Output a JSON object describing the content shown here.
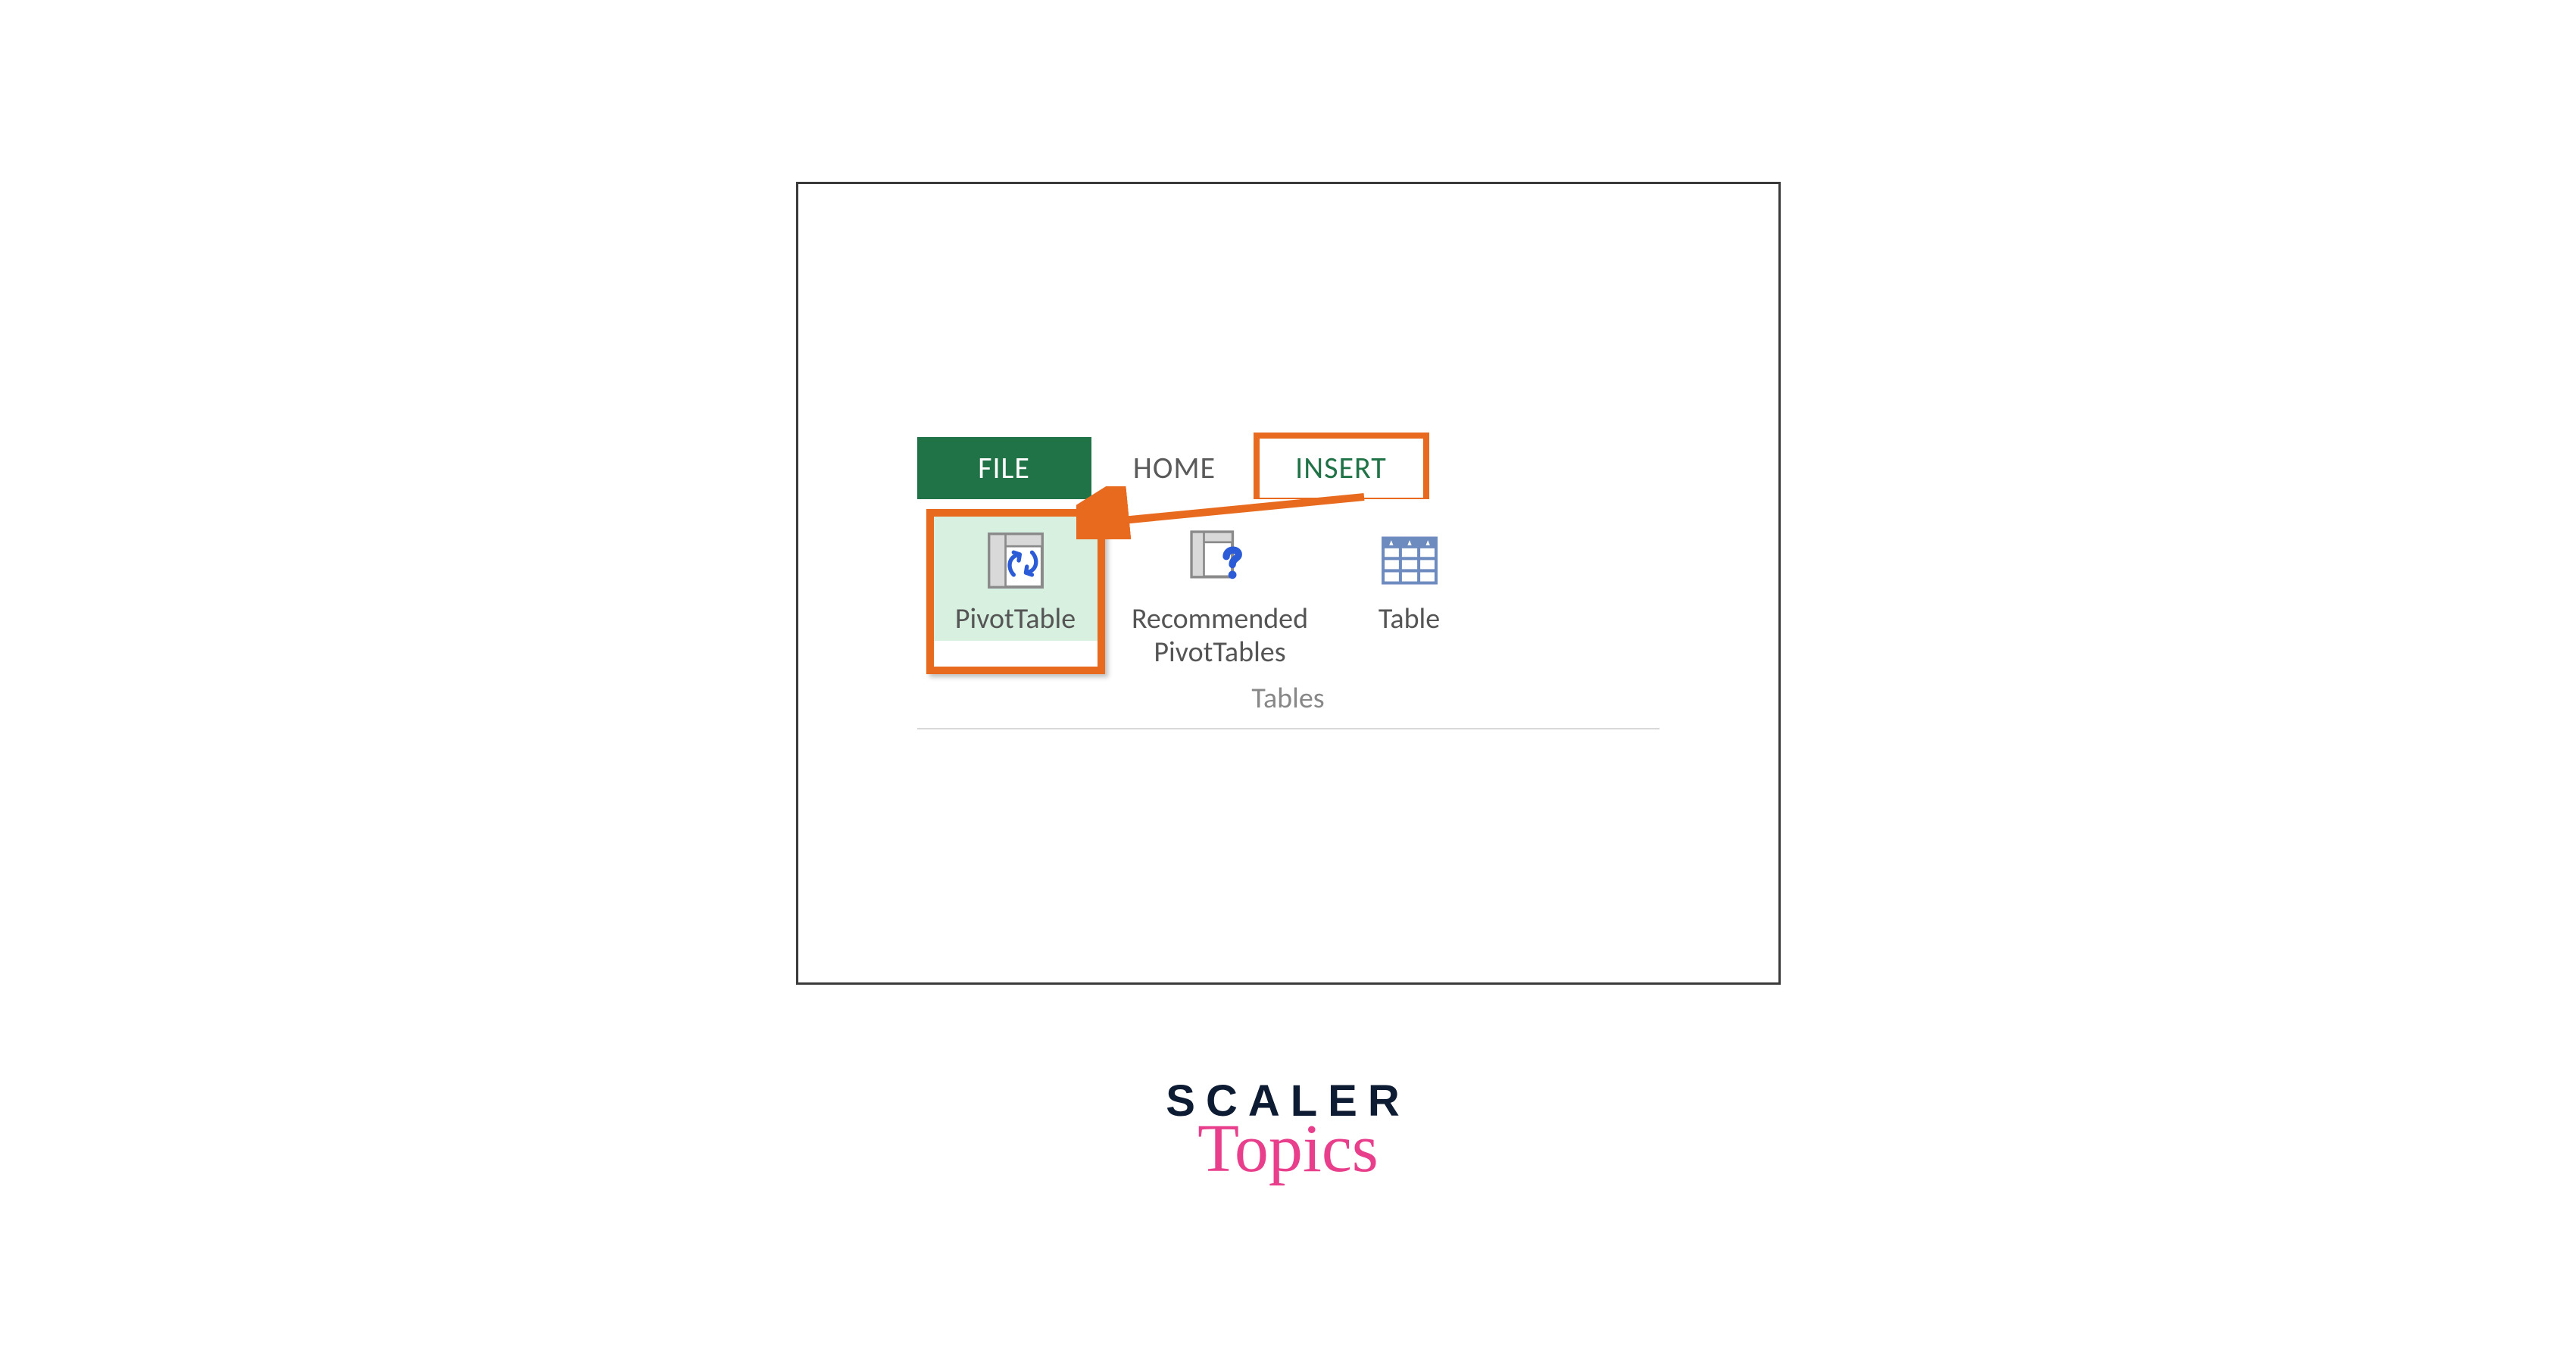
{
  "tabs": {
    "file": "FILE",
    "home": "HOME",
    "insert": "INSERT"
  },
  "commands": {
    "pivot_table": "PivotTable",
    "recommended": "Recommended\nPivotTables",
    "table": "Table"
  },
  "group_caption": "Tables",
  "highlight_color": "#e86a1f",
  "excel_accent": "#207346",
  "brand": {
    "line1": "SCALER",
    "line2": "Topics"
  },
  "icons": {
    "pivot_table": "pivot-table-icon",
    "recommended": "recommended-pivot-icon",
    "table": "table-icon"
  }
}
